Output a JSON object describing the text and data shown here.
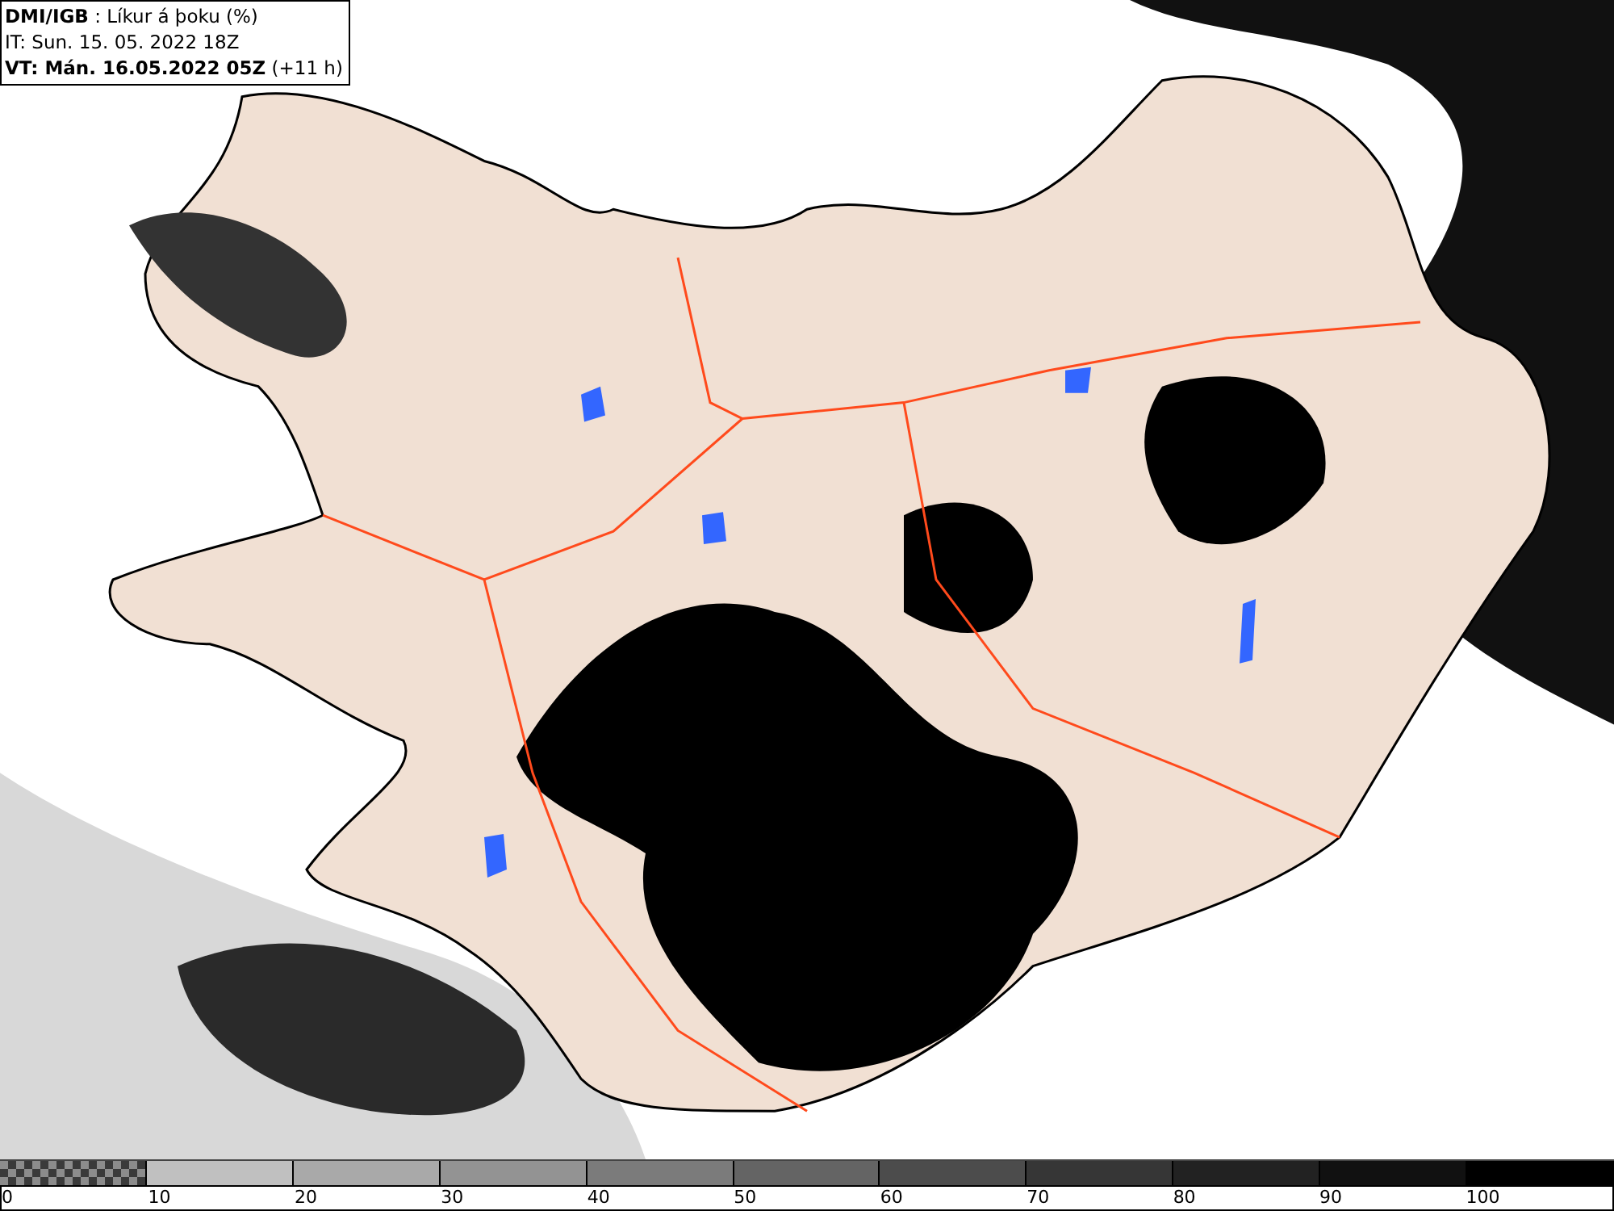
{
  "header": {
    "title": "**DMI/IGB** : Líkur á þoku (%)",
    "issue_time": "IT: Sun. 15. 05. 2022 18Z",
    "valid_time": "**VT: Mán. 16.05.2022 05Z** (+11 h)"
  },
  "legend": {
    "segments": [
      {
        "kind": "checkered",
        "color": "#8c8c8c"
      },
      {
        "kind": "solid",
        "color": "#c0c0c0"
      },
      {
        "kind": "solid",
        "color": "#a9a9a9"
      },
      {
        "kind": "solid",
        "color": "#939393"
      },
      {
        "kind": "solid",
        "color": "#7b7b7b"
      },
      {
        "kind": "solid",
        "color": "#646464"
      },
      {
        "kind": "solid",
        "color": "#4c4c4c"
      },
      {
        "kind": "solid",
        "color": "#363636"
      },
      {
        "kind": "solid",
        "color": "#222222"
      },
      {
        "kind": "solid",
        "color": "#111111"
      },
      {
        "kind": "solid",
        "color": "#000000"
      }
    ],
    "labels": [
      "0",
      "10",
      "20",
      "30",
      "40",
      "50",
      "60",
      "70",
      "80",
      "90",
      "100"
    ]
  }
}
